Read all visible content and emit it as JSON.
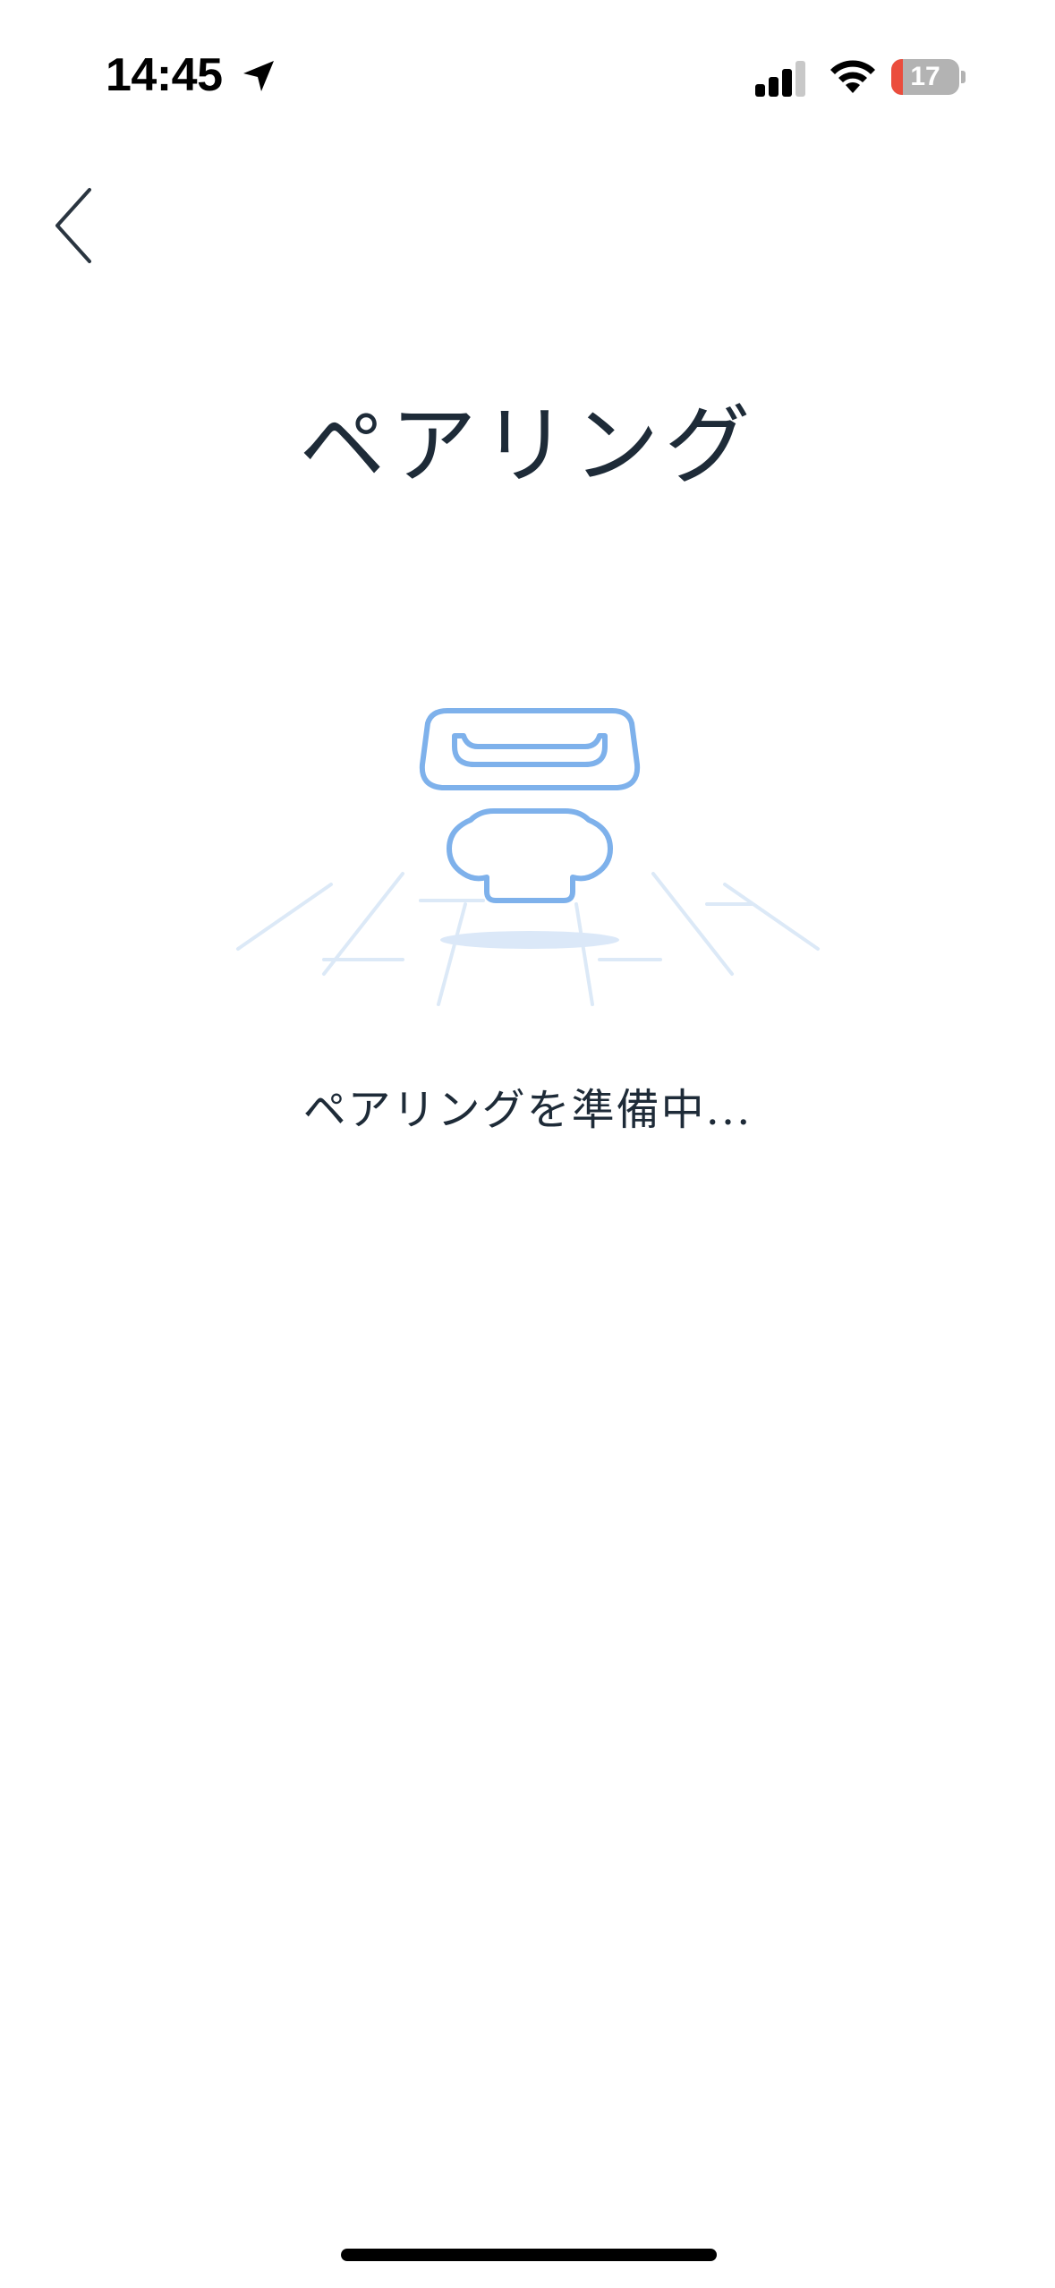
{
  "status_bar": {
    "time": "14:45",
    "battery_level": "17",
    "battery_fraction": 0.17,
    "battery_low_color": "#eb4d3d",
    "icons": [
      "location-arrow-icon",
      "cellular-signal-icon",
      "wifi-icon",
      "battery-icon"
    ]
  },
  "nav": {
    "back_icon": "chevron-left-icon"
  },
  "page": {
    "title": "ペアリング",
    "status_text": "ペアリングを準備中...",
    "illustration": "device-pairing-illustration",
    "accent_color": "#7eb1eb"
  }
}
